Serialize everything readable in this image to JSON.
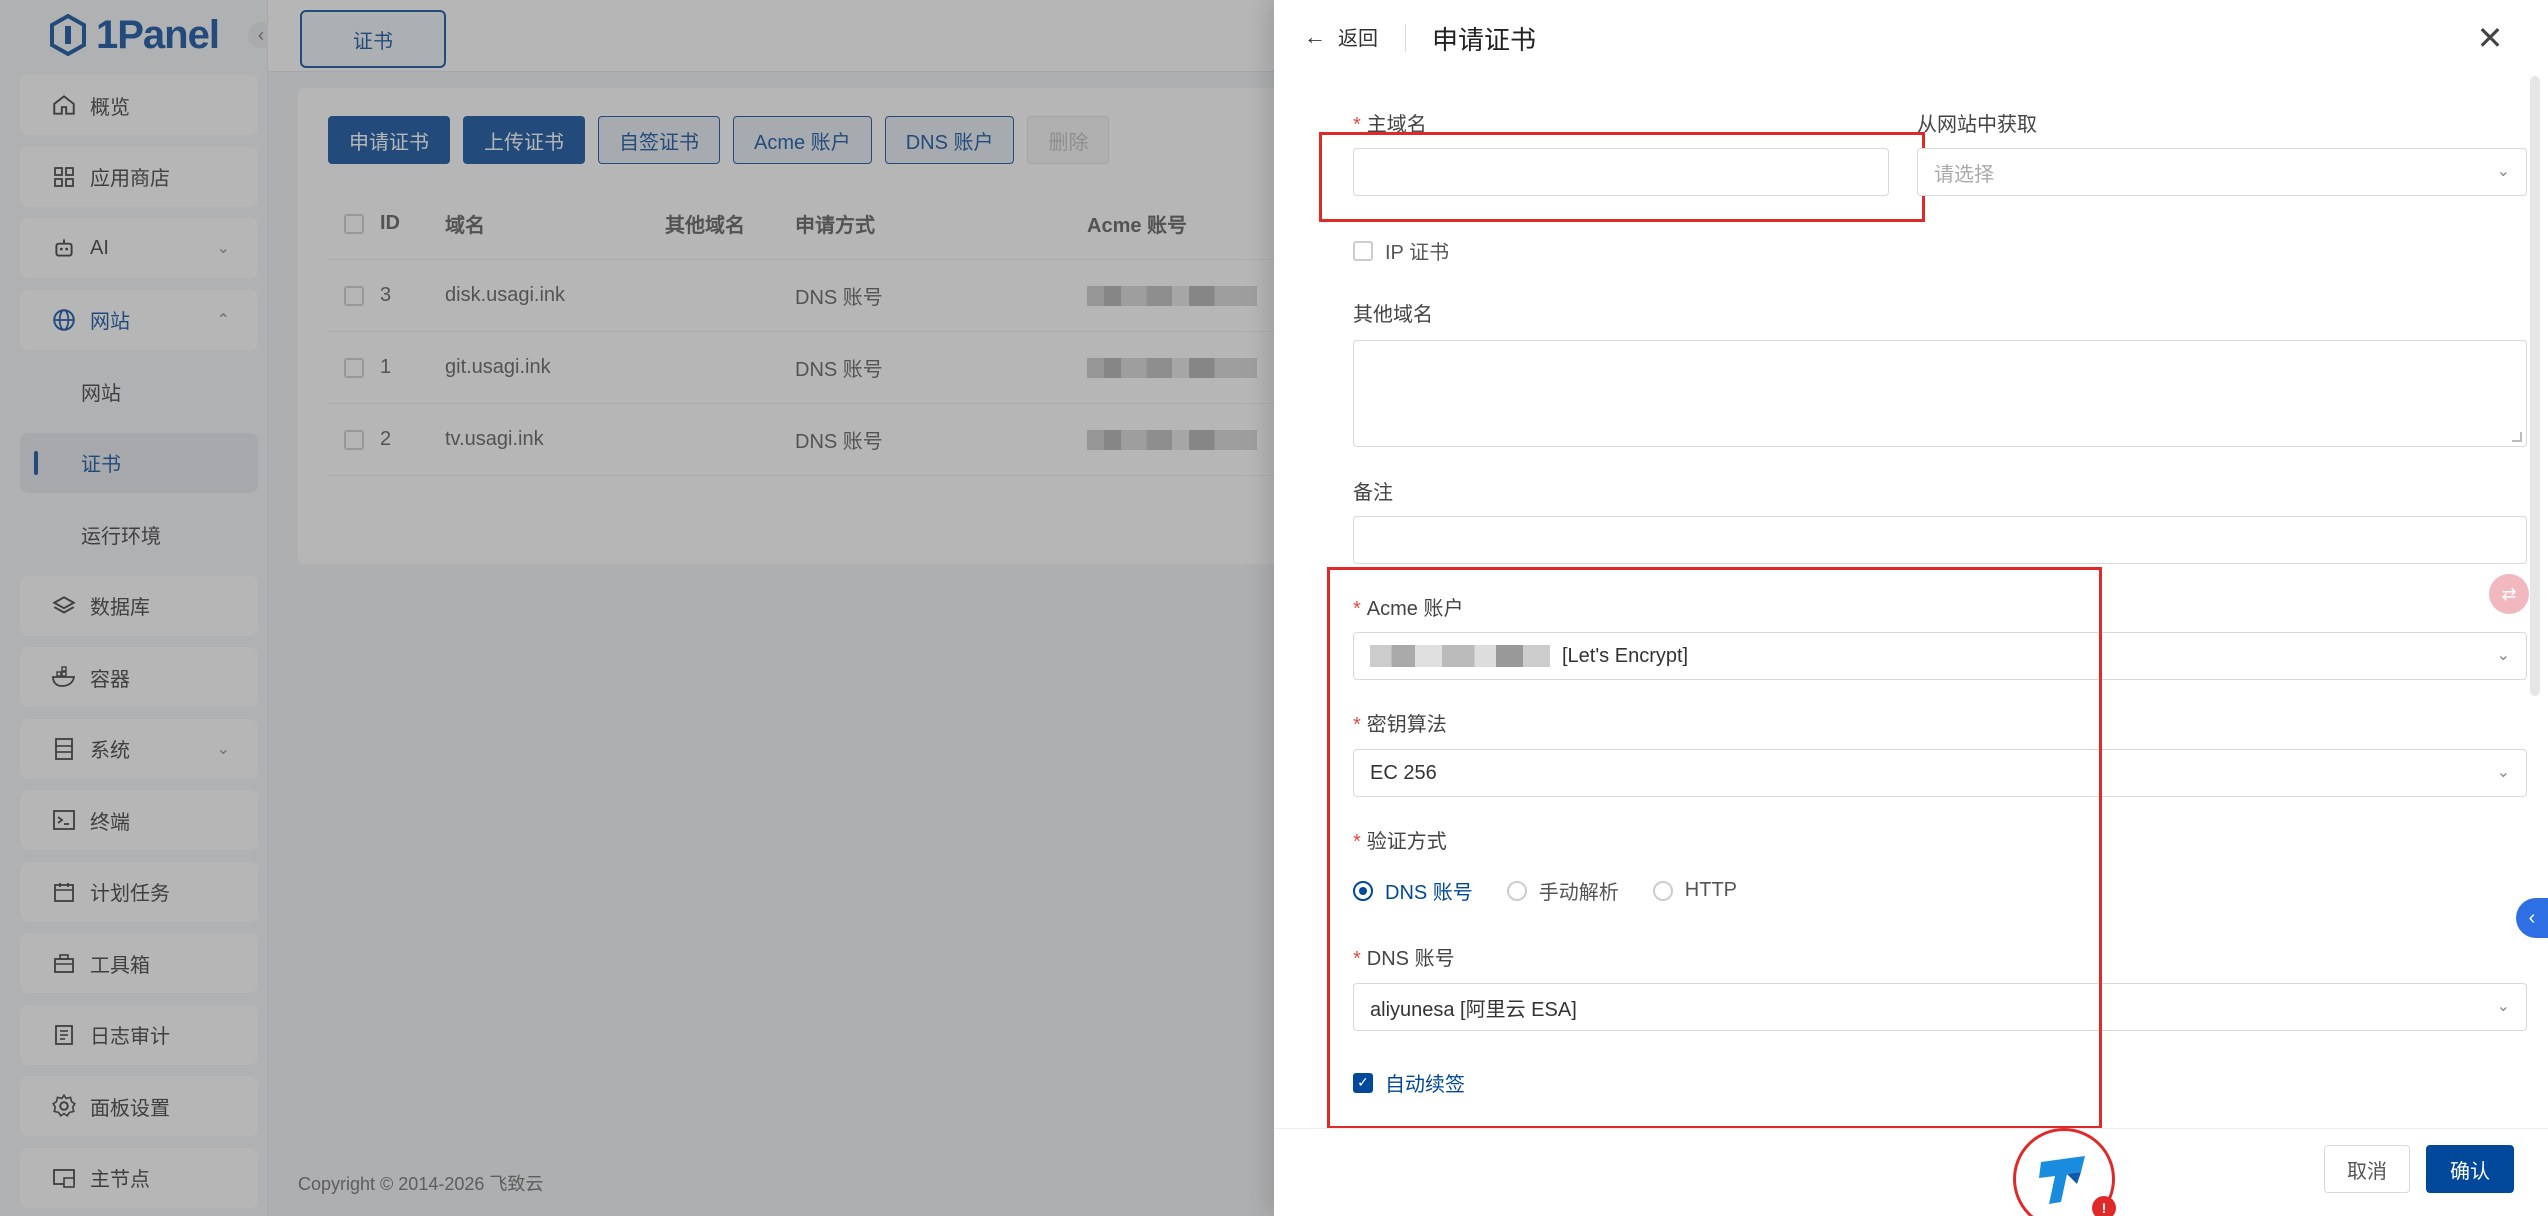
{
  "app": {
    "logo_text": "1Panel"
  },
  "sidebar": {
    "items": [
      {
        "label": "概览",
        "icon": "home-icon"
      },
      {
        "label": "应用商店",
        "icon": "grid-icon"
      },
      {
        "label": "AI",
        "icon": "robot-icon"
      },
      {
        "label": "网站",
        "icon": "globe-icon"
      },
      {
        "label": "网站",
        "icon": ""
      },
      {
        "label": "证书",
        "icon": ""
      },
      {
        "label": "运行环境",
        "icon": ""
      },
      {
        "label": "数据库",
        "icon": "layers-icon"
      },
      {
        "label": "容器",
        "icon": "container-icon"
      },
      {
        "label": "系统",
        "icon": "server-icon"
      },
      {
        "label": "终端",
        "icon": "terminal-icon"
      },
      {
        "label": "计划任务",
        "icon": "calendar-icon"
      },
      {
        "label": "工具箱",
        "icon": "toolbox-icon"
      },
      {
        "label": "日志审计",
        "icon": "log-icon"
      },
      {
        "label": "面板设置",
        "icon": "settings-icon"
      },
      {
        "label": "主节点",
        "icon": "node-icon"
      }
    ]
  },
  "topbar": {
    "tab_label": "证书"
  },
  "toolbar": {
    "apply_label": "申请证书",
    "upload_label": "上传证书",
    "selfsign_label": "自签证书",
    "acme_label": "Acme 账户",
    "dns_label": "DNS 账户",
    "delete_label": "删除"
  },
  "table": {
    "headers": [
      "ID",
      "域名",
      "其他域名",
      "申请方式",
      "Acme 账号"
    ],
    "rows": [
      {
        "id": "3",
        "domain": "disk.usagi.ink",
        "other": "",
        "method": "DNS 账号"
      },
      {
        "id": "1",
        "domain": "git.usagi.ink",
        "other": "",
        "method": "DNS 账号"
      },
      {
        "id": "2",
        "domain": "tv.usagi.ink",
        "other": "",
        "method": "DNS 账号"
      }
    ]
  },
  "footer": {
    "copyright": "Copyright © 2014-2026 飞致云"
  },
  "drawer": {
    "back_label": "返回",
    "title": "申请证书",
    "primary_domain_label": "主域名",
    "primary_domain_value": "",
    "from_site_label": "从网站中获取",
    "from_site_placeholder": "请选择",
    "ip_cert_label": "IP 证书",
    "other_domains_label": "其他域名",
    "remark_label": "备注",
    "acme_account_label": "Acme 账户",
    "acme_account_value": "[Let's Encrypt]",
    "key_algo_label": "密钥算法",
    "key_algo_value": "EC 256",
    "verify_label": "验证方式",
    "verify_options": [
      "DNS 账号",
      "手动解析",
      "HTTP"
    ],
    "verify_selected": "DNS 账号",
    "dns_account_label": "DNS 账号",
    "dns_account_value": "aliyunesa [阿里云 ESA]",
    "auto_renew_label": "自动续签",
    "auto_renew_checked": true,
    "cancel_label": "取消",
    "confirm_label": "确认"
  },
  "floating": {
    "badge_text": "!"
  },
  "colors": {
    "primary": "#004899",
    "required": "#e5483f",
    "highlight": "#e02a2a"
  }
}
